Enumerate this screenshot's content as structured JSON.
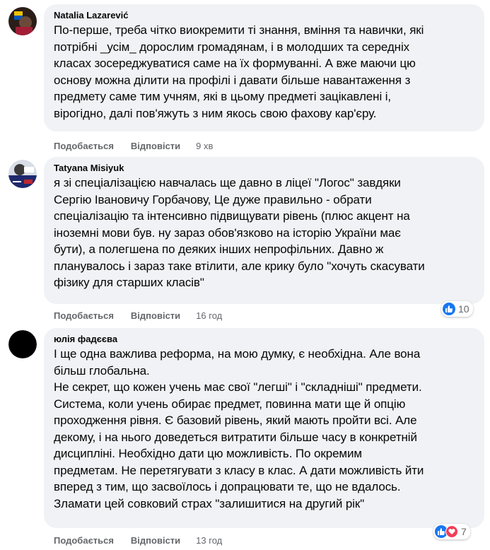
{
  "comments": [
    {
      "author": "Natalia Lazarević",
      "text": "По-перше, треба чітко виокремити ті знання, вміння та навички, які\nпотрібні _усім_ дорослим громадянам, і в молодших та середніх\nкласах зосереджуватися саме на їх формуванні. А вже маючи цю\nоснову можна ділити на профілі і давати більше навантаження з\nпредмету саме тим учням, які в цьому предметі зацікавлені і,\nвірогідно, далі пов'яжуть з ним якось свою фахову кар'єру.",
      "like_label": "Подобається",
      "reply_label": "Відповісти",
      "time": "9 хв"
    },
    {
      "author": "Tatyana Misiyuk",
      "text": "я зі спеціалізацією навчалась ще давно в ліцеї \"Логос\" завдяки\nСергію Івановичу Горбачову, Це дуже правильно - обрати\nспеціалізацію та інтенсивно підвищувати рівень (плюс акцент на\nіноземні мови був. ну зараз обов'язково на історію України має\nбути), а полегшена по деяких інших непрофільних. Давно ж\nпланувалось і зараз таке втілити, але крику було \"хочуть скасувати\nфізику для старших класів\"",
      "like_label": "Подобається",
      "reply_label": "Відповісти",
      "time": "16 год",
      "reaction_count": "10"
    },
    {
      "author": "юлія фадєєва",
      "text": "І ще одна важлива реформа, на мою думку, є необхідна. Але вона\nбільш глобальна.\nНе секрет, що кожен учень має свої \"легші\" і \"складніші\" предмети.\nСистема, коли учень обирає предмет, повинна мати ще й опцію\nпроходження рівня. Є базовий рівень, який мають пройти всі. Але\nдекому, і на нього доведеться витратити більше часу в конкретній\nдисципліні. Необхідно дати цю можливість. По окремим\nпредметам. Не перетягувати з класу в клас. А дати можливість йти\nвперед з тим, що засвоїлось і допрацювати те, що не вдалось.\nЗламати цей совковий страх \"залишитися на другий рік\"",
      "like_label": "Подобається",
      "reply_label": "Відповісти",
      "time": "13 год",
      "reaction_count": "7"
    }
  ],
  "colors": {
    "bubble": "#f0f2f5",
    "meta": "#65676b",
    "like": "#1877f2",
    "love": "#f33e58"
  }
}
